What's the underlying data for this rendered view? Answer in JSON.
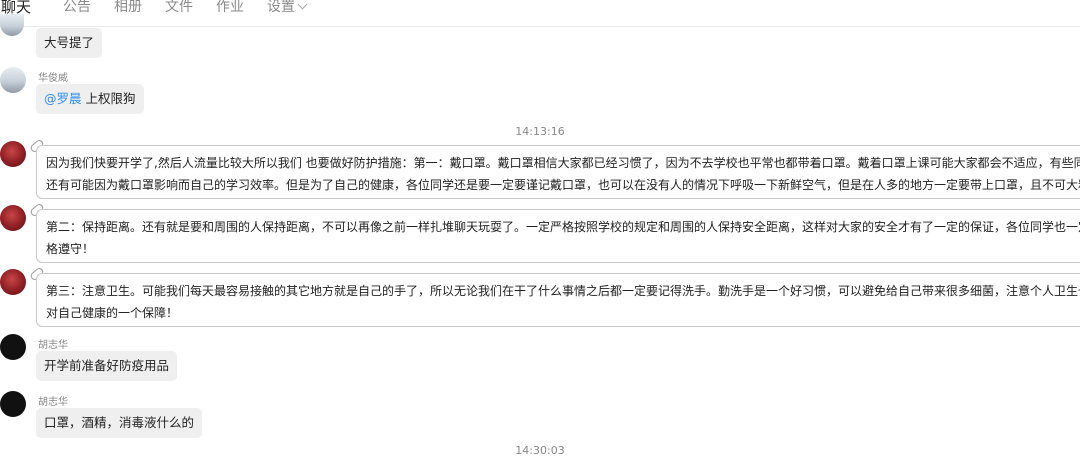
{
  "tabs": [
    {
      "label": "聊天",
      "active": true
    },
    {
      "label": "公告"
    },
    {
      "label": "相册"
    },
    {
      "label": "文件"
    },
    {
      "label": "作业"
    },
    {
      "label": "设置"
    }
  ],
  "messages": {
    "m0": {
      "text": "大号提了"
    },
    "m1": {
      "sender": "华俊威",
      "mention": "@罗晨",
      "text": " 上权限狗"
    },
    "time1": "14:13:16",
    "notice1": {
      "line1": "因为我们快要开学了,然后人流量比较大所以我们 也要做好防护措施：第一：戴口罩。戴口罩相信大家都已经习惯了，因为不去学校也平常也都带着口罩。戴着口罩上课可能大家都会不适应，有些同",
      "line2": "还有可能因为戴口罩影响而自己的学习效率。但是为了自己的健康，各位同学还是要一定要谨记戴口罩，也可以在没有人的情况下呼吸一下新鲜空气，但是在人多的地方一定要带上口罩，且不可大粗"
    },
    "notice2": {
      "line1": "第二：保持距离。还有就是要和周围的人保持距离，不可以再像之前一样扎堆聊天玩耍了。一定严格按照学校的规定和周围的人保持安全距离，这样对大家的安全才有了一定的保证，各位同学也一定",
      "line2": "格遵守！"
    },
    "notice3": {
      "line1": "第三：注意卫生。可能我们每天最容易接触的其它地方就是自己的手了，所以无论我们在干了什么事情之后都一定要记得洗手。勤洗手是一个好习惯，可以避免给自己带来很多细菌，注意个人卫生也",
      "line2": "对自己健康的一个保障！"
    },
    "m5": {
      "sender": "胡志华",
      "text": "开学前准备好防疫用品"
    },
    "m6": {
      "sender": "胡志华",
      "text": "口罩，酒精，消毒液什么的"
    },
    "time2": "14:30:03"
  }
}
